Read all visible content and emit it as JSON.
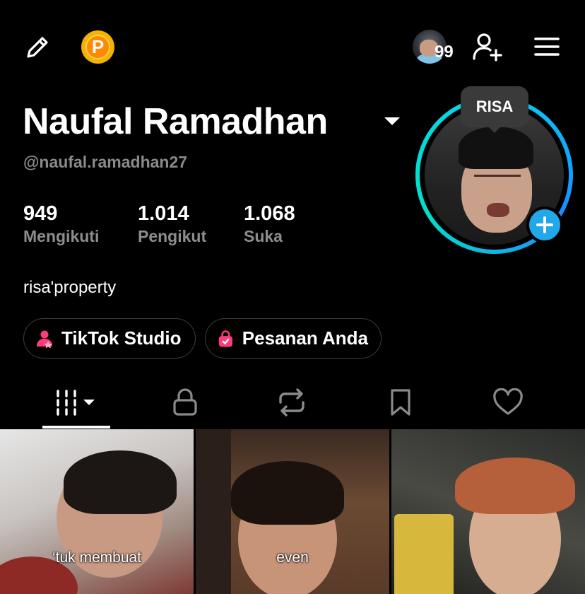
{
  "profile": {
    "display_name": "Naufal Ramadhan",
    "username": "@naufal.ramadhan27",
    "bio": "risa'property",
    "note_tooltip": "RISA"
  },
  "stats": [
    {
      "value": "949",
      "label": "Mengikuti"
    },
    {
      "value": "1.014",
      "label": "Pengikut"
    },
    {
      "value": "1.068",
      "label": "Suka"
    }
  ],
  "notifications": {
    "count": "99"
  },
  "buttons": {
    "tiktok_studio": "TikTok Studio",
    "orders": "Pesanan Anda"
  },
  "coin": {
    "letter": "P"
  },
  "tabs": [
    {
      "icon": "videos-grid-icon",
      "active": true
    },
    {
      "icon": "lock-icon",
      "active": false
    },
    {
      "icon": "repost-icon",
      "active": false
    },
    {
      "icon": "bookmark-icon",
      "active": false
    },
    {
      "icon": "heart-icon",
      "active": false
    }
  ],
  "videos": [
    {
      "caption": "‘tuk membuat"
    },
    {
      "caption": "even"
    },
    {
      "caption": ""
    }
  ],
  "colors": {
    "background": "#000000",
    "secondary_text": "#8d8d8d",
    "ring_accent": "#00d6f0",
    "add_badge": "#20a8e8",
    "coin": "#f5b301"
  }
}
